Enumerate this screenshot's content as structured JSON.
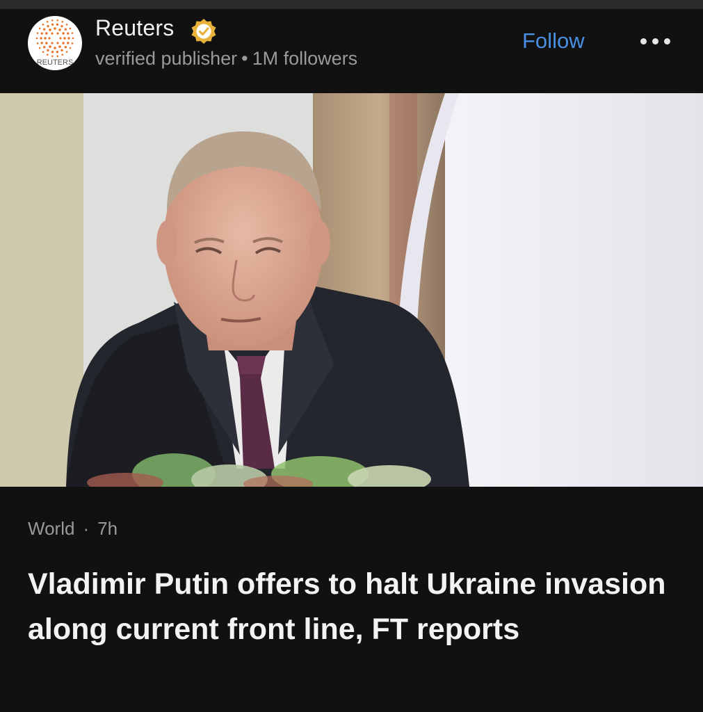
{
  "publisher": {
    "logo_text": "REUTERS",
    "name": "Reuters",
    "subtitle": "verified publisher",
    "separator": "•",
    "followers": "1M followers",
    "follow_label": "Follow",
    "verified_icon": "verified-check-icon",
    "more_icon": "more-horizontal-icon"
  },
  "article": {
    "image_description": "news-photo",
    "category": "World",
    "meta_separator": "·",
    "time_ago": "7h",
    "headline": "Vladimir Putin offers to halt Ukraine invasion along current front line, FT reports"
  },
  "colors": {
    "background": "#111111",
    "accent": "#4a90e2",
    "muted_text": "#9a9a9a",
    "verified_badge": "#e8b23a",
    "logo_dots": "#e8742a"
  }
}
